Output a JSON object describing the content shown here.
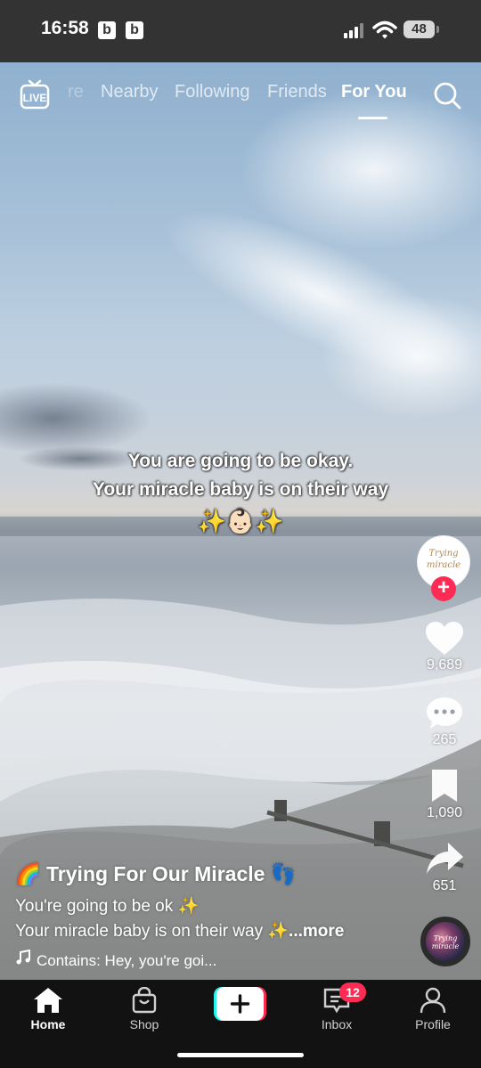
{
  "status_bar": {
    "time": "16:58",
    "badges": [
      "b",
      "b"
    ],
    "battery": "48"
  },
  "top_nav": {
    "cut_tab": "re",
    "tabs": [
      "Nearby",
      "Following",
      "Friends",
      "For You"
    ],
    "active_tab": "For You",
    "live_label": "LIVE"
  },
  "captions": {
    "line1": "You are going to be okay.",
    "line2": "Your miracle baby is on their way",
    "line3": "✨👶🏻✨"
  },
  "creator": {
    "avatar_text": "Trying miracle",
    "follow_symbol": "+"
  },
  "actions": {
    "likes": "9,689",
    "comments": "265",
    "saves": "1,090",
    "shares": "651"
  },
  "post": {
    "author": "🌈 Trying For Our Miracle 👣",
    "line1": "You're going to be ok ✨",
    "line2": "Your miracle baby is on their way ✨",
    "more": "...more",
    "music": "Contains: Hey, you're goi..."
  },
  "bottom_nav": {
    "home": "Home",
    "shop": "Shop",
    "inbox": "Inbox",
    "inbox_badge": "12",
    "profile": "Profile"
  },
  "colors": {
    "accent": "#fe2c55",
    "cyan": "#25f4ee",
    "nav_bg": "#121212",
    "status_bg": "#333333"
  }
}
